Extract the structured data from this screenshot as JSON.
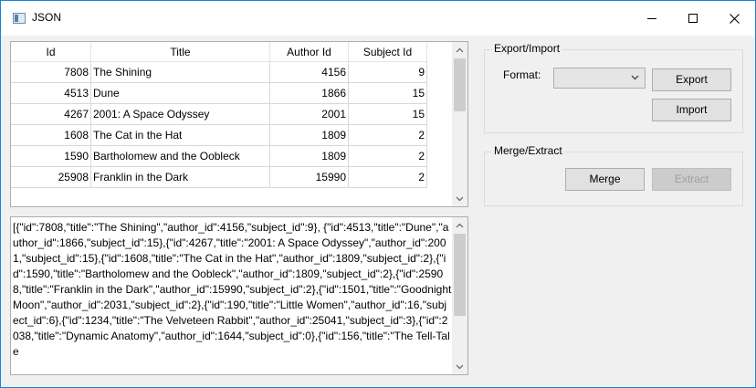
{
  "window": {
    "title": "JSON"
  },
  "table": {
    "headers": {
      "id": "Id",
      "title": "Title",
      "author_id": "Author Id",
      "subject_id": "Subject Id"
    },
    "rows": [
      {
        "id": "7808",
        "title": "The Shining",
        "author_id": "4156",
        "subject_id": "9"
      },
      {
        "id": "4513",
        "title": "Dune",
        "author_id": "1866",
        "subject_id": "15"
      },
      {
        "id": "4267",
        "title": "2001: A Space Odyssey",
        "author_id": "2001",
        "subject_id": "15"
      },
      {
        "id": "1608",
        "title": "The Cat in the Hat",
        "author_id": "1809",
        "subject_id": "2"
      },
      {
        "id": "1590",
        "title": "Bartholomew and the Oobleck",
        "author_id": "1809",
        "subject_id": "2"
      },
      {
        "id": "25908",
        "title": "Franklin in the Dark",
        "author_id": "15990",
        "subject_id": "2"
      }
    ]
  },
  "json_text": "[{\"id\":7808,\"title\":\"The Shining\",\"author_id\":4156,\"subject_id\":9}, {\"id\":4513,\"title\":\"Dune\",\"author_id\":1866,\"subject_id\":15},{\"id\":4267,\"title\":\"2001: A Space Odyssey\",\"author_id\":2001,\"subject_id\":15},{\"id\":1608,\"title\":\"The Cat in the Hat\",\"author_id\":1809,\"subject_id\":2},{\"id\":1590,\"title\":\"Bartholomew and the Oobleck\",\"author_id\":1809,\"subject_id\":2},{\"id\":25908,\"title\":\"Franklin in the Dark\",\"author_id\":15990,\"subject_id\":2},{\"id\":1501,\"title\":\"Goodnight Moon\",\"author_id\":2031,\"subject_id\":2},{\"id\":190,\"title\":\"Little Women\",\"author_id\":16,\"subject_id\":6},{\"id\":1234,\"title\":\"The Velveteen Rabbit\",\"author_id\":25041,\"subject_id\":3},{\"id\":2038,\"title\":\"Dynamic Anatomy\",\"author_id\":1644,\"subject_id\":0},{\"id\":156,\"title\":\"The Tell-Tale",
  "export_import": {
    "title": "Export/Import",
    "format_label": "Format:",
    "format_value": "",
    "export_label": "Export",
    "import_label": "Import"
  },
  "merge_extract": {
    "title": "Merge/Extract",
    "merge_label": "Merge",
    "extract_label": "Extract"
  }
}
